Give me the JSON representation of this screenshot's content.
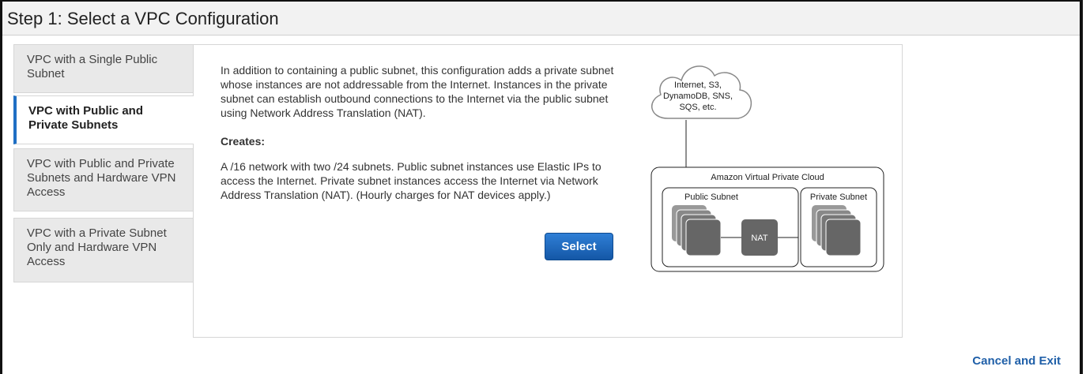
{
  "header": {
    "title": "Step 1: Select a VPC Configuration"
  },
  "tabs": [
    {
      "label": "VPC with a Single Public Subnet",
      "active": false
    },
    {
      "label": "VPC with Public and Private Subnets",
      "active": true
    },
    {
      "label": "VPC with Public and Private Subnets and Hardware VPN Access",
      "active": false
    },
    {
      "label": "VPC with a Private Subnet Only and Hardware VPN Access",
      "active": false
    }
  ],
  "main": {
    "description": "In addition to containing a public subnet, this configuration adds a private subnet whose instances are not addressable from the Internet. Instances in the private subnet can establish outbound connections to the Internet via the public subnet using Network Address Translation (NAT).",
    "creates_label": "Creates:",
    "creates_text": "A /16 network with two /24 subnets. Public subnet instances use Elastic IPs to access the Internet. Private subnet instances access the Internet via Network Address Translation (NAT). (Hourly charges for NAT devices apply.)",
    "select_label": "Select"
  },
  "diagram": {
    "cloud_line1": "Internet, S3,",
    "cloud_line2": "DynamoDB, SNS,",
    "cloud_line3": "SQS, etc.",
    "vpc_label": "Amazon Virtual Private Cloud",
    "public_subnet": "Public Subnet",
    "private_subnet": "Private Subnet",
    "nat_label": "NAT"
  },
  "footer": {
    "cancel_label": "Cancel and Exit"
  },
  "colors": {
    "accent": "#1f6fc4",
    "button": "#1f68bd",
    "link": "#1f5fa8",
    "instance": "#666666"
  }
}
